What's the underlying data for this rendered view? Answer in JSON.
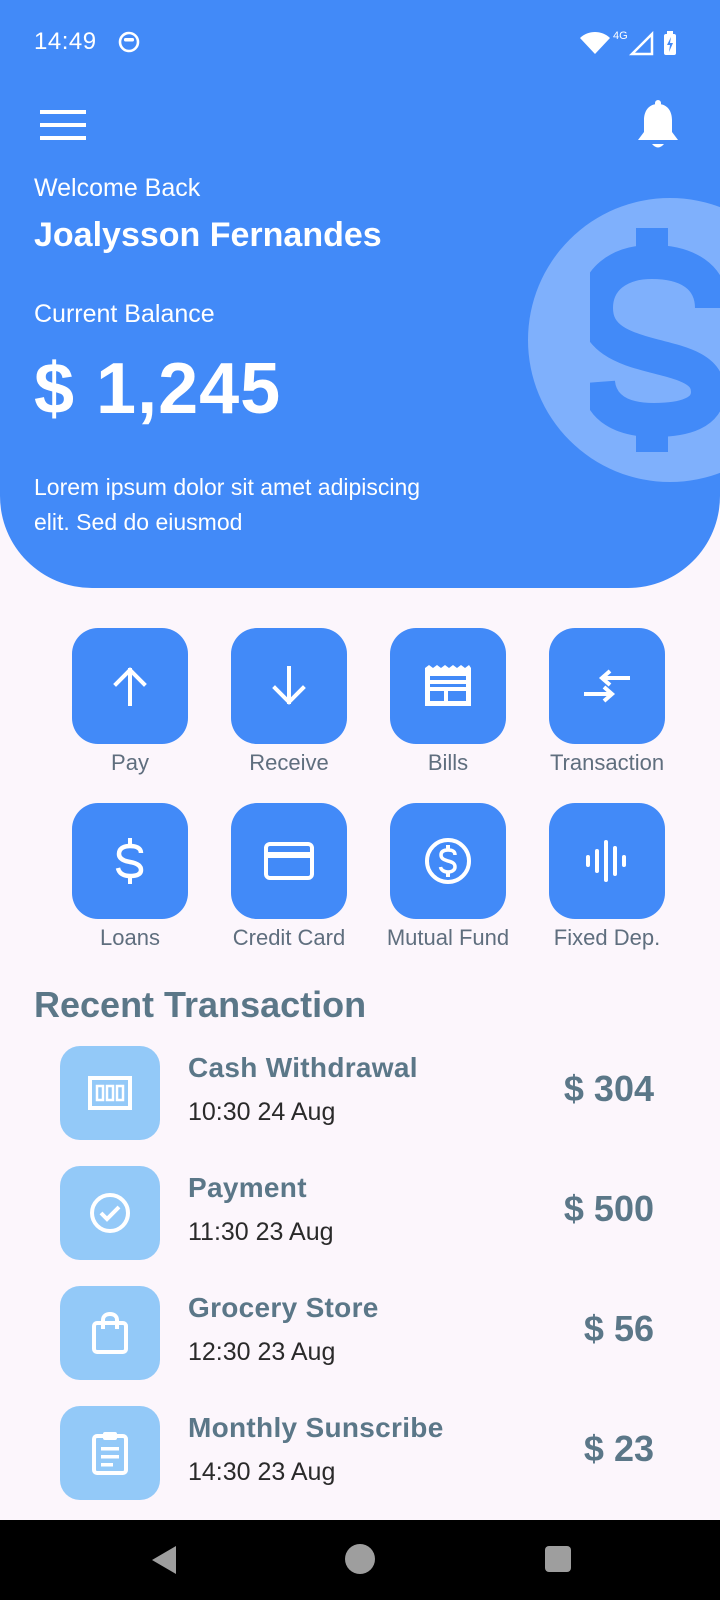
{
  "status_bar": {
    "time": "14:49",
    "network": "4G"
  },
  "header": {
    "welcome": "Welcome Back",
    "user_name": "Joalysson Fernandes",
    "balance_label": "Current Balance",
    "balance_amount": "$ 1,245",
    "description": "Lorem ipsum dolor sit amet adipiscing elit. Sed do eiusmod",
    "colors": {
      "primary": "#428af8",
      "coin": "#7fb0fc"
    }
  },
  "actions": [
    {
      "label": "Pay",
      "icon": "arrow-up-icon"
    },
    {
      "label": "Receive",
      "icon": "arrow-down-icon"
    },
    {
      "label": "Bills",
      "icon": "bill-icon"
    },
    {
      "label": "Transaction",
      "icon": "swap-arrows-icon"
    },
    {
      "label": "Loans",
      "icon": "dollar-icon"
    },
    {
      "label": "Credit Card",
      "icon": "credit-card-icon"
    },
    {
      "label": "Mutual Fund",
      "icon": "dollar-circle-icon"
    },
    {
      "label": "Fixed Dep.",
      "icon": "waveform-icon"
    }
  ],
  "recent": {
    "title": "Recent Transaction",
    "items": [
      {
        "title": "Cash Withdrawal",
        "time": "10:30 24 Aug",
        "amount": "$ 304",
        "icon": "cash-icon"
      },
      {
        "title": "Payment",
        "time": "11:30 23 Aug",
        "amount": "$ 500",
        "icon": "check-circle-icon"
      },
      {
        "title": "Grocery Store",
        "time": "12:30 23 Aug",
        "amount": "$ 56",
        "icon": "shopping-bag-icon"
      },
      {
        "title": "Monthly Sunscribe",
        "time": "14:30 23 Aug",
        "amount": "$ 23",
        "icon": "clipboard-icon"
      }
    ]
  }
}
